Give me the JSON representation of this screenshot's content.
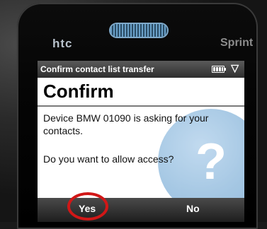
{
  "device": {
    "brand_left": "htc",
    "brand_right": "Sprint"
  },
  "dialog": {
    "title": "Confirm contact list transfer",
    "heading": "Confirm",
    "message": "Device BMW 01090 is asking for your contacts.",
    "question": "Do you want to allow access?",
    "help_glyph": "?"
  },
  "softkeys": {
    "left": "Yes",
    "right": "No"
  },
  "status_icons": [
    "battery-icon",
    "signal-icon"
  ],
  "colors": {
    "annotation": "#d11717",
    "help_circle": "#7fb0d8"
  }
}
